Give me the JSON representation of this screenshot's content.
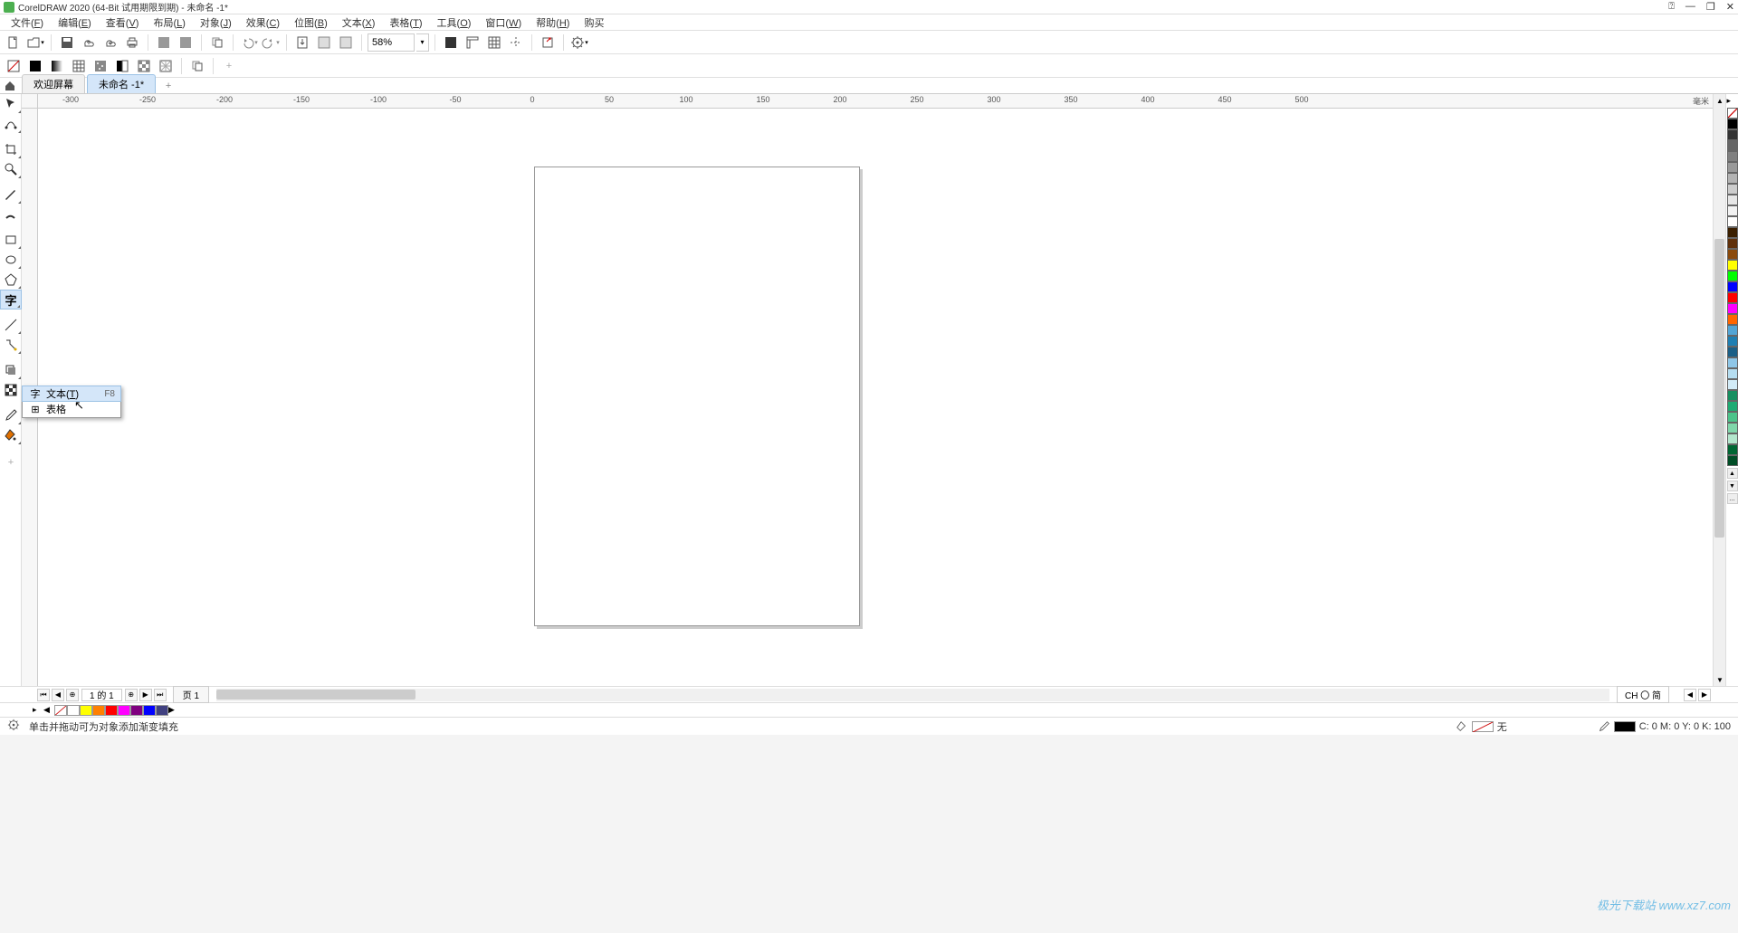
{
  "titlebar": {
    "title": "CorelDRAW 2020 (64-Bit 试用期限到期) - 未命名 -1*"
  },
  "menubar": {
    "items": [
      {
        "label": "文件",
        "accel": "F"
      },
      {
        "label": "编辑",
        "accel": "E"
      },
      {
        "label": "查看",
        "accel": "V"
      },
      {
        "label": "布局",
        "accel": "L"
      },
      {
        "label": "对象",
        "accel": "J"
      },
      {
        "label": "效果",
        "accel": "C"
      },
      {
        "label": "位图",
        "accel": "B"
      },
      {
        "label": "文本",
        "accel": "X"
      },
      {
        "label": "表格",
        "accel": "T"
      },
      {
        "label": "工具",
        "accel": "O"
      },
      {
        "label": "窗口",
        "accel": "W"
      },
      {
        "label": "帮助",
        "accel": "H"
      },
      {
        "label": "购买",
        "accel": ""
      }
    ]
  },
  "toolbar": {
    "zoom": "58%"
  },
  "doc_tabs": {
    "welcome": "欢迎屏幕",
    "active": "未命名 -1*"
  },
  "ruler": {
    "unit": "毫米",
    "h_ticks": [
      -300,
      -250,
      -200,
      -150,
      -100,
      -50,
      0,
      50,
      100,
      150,
      200,
      250,
      300,
      350,
      400,
      450,
      500
    ],
    "h_positions": [
      36,
      121,
      206,
      291,
      376,
      461,
      546,
      631,
      716,
      801,
      886,
      971,
      1056,
      1141,
      1226,
      1311,
      1396
    ]
  },
  "flyout": {
    "items": [
      {
        "label": "文本",
        "accel": "T",
        "shortcut": "F8",
        "glyph": "字"
      },
      {
        "label": "表格",
        "accel": "",
        "shortcut": "",
        "glyph": "⊞"
      }
    ]
  },
  "page_nav": {
    "current": "1 的 1",
    "page_tab": "页 1"
  },
  "ime": "CH 〇 简",
  "status": {
    "hint": "单击并拖动可为对象添加渐变填充",
    "fill_none": "无",
    "coords": "C:  0 M:  0 Y:  0 K: 100"
  },
  "palette": {
    "colors": [
      "#000000",
      "#333333",
      "#666666",
      "#808080",
      "#999999",
      "#b3b3b3",
      "#cccccc",
      "#e6e6e6",
      "#f2f2f2",
      "#ffffff",
      "#3b1f00",
      "#60300a",
      "#8a4a0c",
      "#ffff00",
      "#00ff00",
      "#0000ff",
      "#ff0000",
      "#ff00ff",
      "#ff6600",
      "#52a5d6",
      "#1f7fb2",
      "#1b5f86",
      "#8fc7e8",
      "#b5ddf0",
      "#d2ebf7",
      "#178f60",
      "#1fab73",
      "#4cc38a",
      "#80d6aa",
      "#b3e6cc",
      "#006633",
      "#004d26"
    ]
  },
  "doc_palette": {
    "colors": [
      "#ffffff",
      "#ffff00",
      "#ff8000",
      "#ff0000",
      "#ff00ff",
      "#800080",
      "#0000ff",
      "#404080"
    ]
  },
  "watermark": "极光下载站  www.xz7.com"
}
